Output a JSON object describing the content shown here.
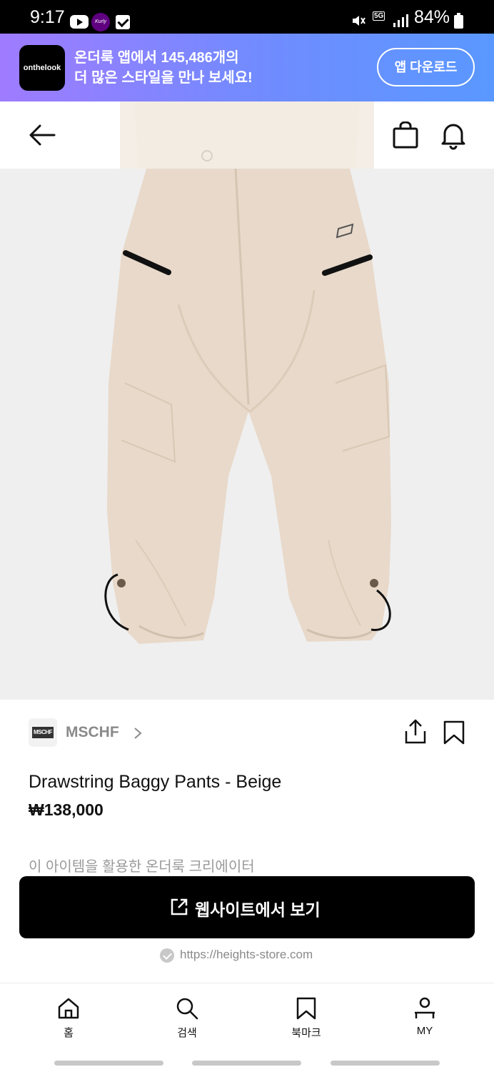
{
  "status_bar": {
    "time": "9:17",
    "battery": "84%",
    "kurly_badge": "Kurly",
    "network": "5G"
  },
  "promo": {
    "logo_text": "onthelook",
    "line1": "온더룩 앱에서 145,486개의",
    "line2": "더 많은 스타일을 만나 보세요!",
    "download_button": "앱 다운로드"
  },
  "brand": {
    "logo_text": "MSCHF",
    "name": "MSCHF"
  },
  "product": {
    "name": "Drawstring Baggy Pants - Beige",
    "price": "₩138,000",
    "color": "#e8d9ca"
  },
  "creators_label": "이 아이템을 활용한 온더룩 크리에이터",
  "cta": {
    "label": "웹사이트에서 보기",
    "url": "https://heights-store.com"
  },
  "bottom_nav": {
    "items": [
      {
        "label": "홈",
        "icon": "home-icon"
      },
      {
        "label": "검색",
        "icon": "search-icon"
      },
      {
        "label": "북마크",
        "icon": "bookmark-icon"
      },
      {
        "label": "MY",
        "icon": "person-icon"
      }
    ]
  },
  "colors": {
    "promo_gradient_start": "#9f7bff",
    "promo_gradient_end": "#5a98ff",
    "cta_background": "#000000",
    "muted_text": "#8a8a8a"
  }
}
